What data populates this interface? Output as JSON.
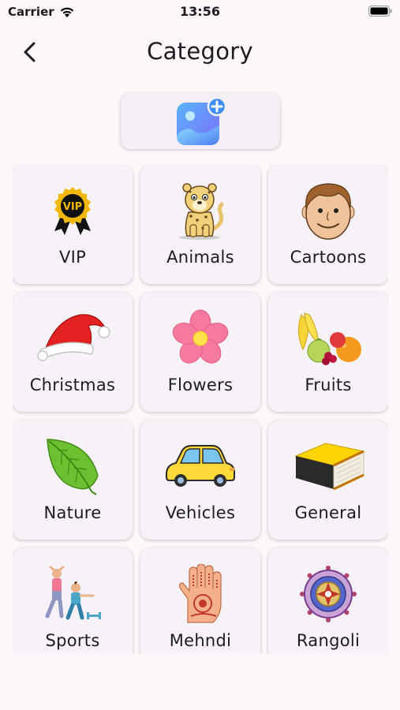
{
  "status_bar": {
    "carrier": "Carrier",
    "time": "13:56"
  },
  "app_bar": {
    "title": "Category",
    "back_icon": "chevron-left-icon"
  },
  "add_image_button": {
    "icon": "add-photo-icon"
  },
  "categories": [
    {
      "label": "VIP",
      "icon": "vip-badge-icon"
    },
    {
      "label": "Animals",
      "icon": "cheetah-icon"
    },
    {
      "label": "Cartoons",
      "icon": "cartoon-face-icon"
    },
    {
      "label": "Christmas",
      "icon": "santa-hat-icon"
    },
    {
      "label": "Flowers",
      "icon": "flower-icon"
    },
    {
      "label": "Fruits",
      "icon": "fruits-icon"
    },
    {
      "label": "Nature",
      "icon": "leaf-icon"
    },
    {
      "label": "Vehicles",
      "icon": "car-icon"
    },
    {
      "label": "General",
      "icon": "book-icon"
    },
    {
      "label": "Sports",
      "icon": "sports-people-icon"
    },
    {
      "label": "Mehndi",
      "icon": "mehndi-hand-icon"
    },
    {
      "label": "Rangoli",
      "icon": "rangoli-icon"
    }
  ],
  "colors": {
    "background": "#fbf7fb",
    "card": "#f6f2f7",
    "text": "#1d1b20"
  }
}
